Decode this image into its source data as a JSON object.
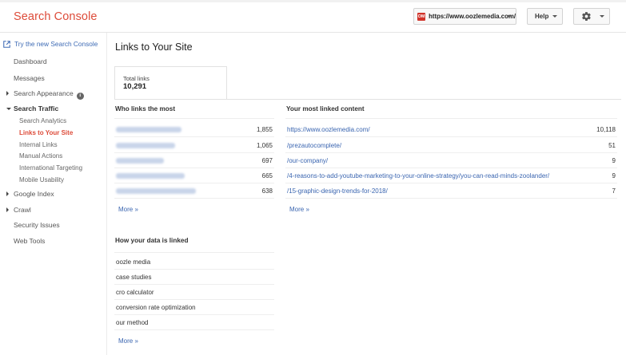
{
  "app": {
    "title": "Search Console",
    "property": "https://www.oozlemedia.com/",
    "favicon_text": "OM",
    "help_label": "Help",
    "brand_color": "#dd4b39",
    "link_color": "#3a65b0"
  },
  "sidebar": {
    "new_link": "Try the new Search Console",
    "items": [
      {
        "label": "Dashboard"
      },
      {
        "label": "Messages"
      },
      {
        "label": "Search Appearance"
      },
      {
        "label": "Search Traffic"
      },
      {
        "label": "Google Index"
      },
      {
        "label": "Crawl"
      },
      {
        "label": "Security Issues"
      },
      {
        "label": "Web Tools"
      }
    ],
    "subitems": [
      {
        "label": "Search Analytics"
      },
      {
        "label": "Links to Your Site",
        "active": true
      },
      {
        "label": "Internal Links"
      },
      {
        "label": "Manual Actions"
      },
      {
        "label": "International Targeting"
      },
      {
        "label": "Mobile Usability"
      }
    ]
  },
  "main": {
    "title": "Links to Your Site",
    "total_label": "Total links",
    "total_value": "10,291",
    "who_links": {
      "title": "Who links the most",
      "rows": [
        {
          "count": "1,855"
        },
        {
          "count": "1,065"
        },
        {
          "count": "697"
        },
        {
          "count": "665"
        },
        {
          "count": "638"
        }
      ],
      "more": "More »"
    },
    "most_linked": {
      "title": "Your most linked content",
      "rows": [
        {
          "url": "https://www.oozlemedia.com/",
          "count": "10,118"
        },
        {
          "url": "/prezautocomplete/",
          "count": "51"
        },
        {
          "url": "/our-company/",
          "count": "9"
        },
        {
          "url": "/4-reasons-to-add-youtube-marketing-to-your-online-strategy/you-can-read-minds-zoolander/",
          "count": "9"
        },
        {
          "url": "/15-graphic-design-trends-for-2018/",
          "count": "7"
        }
      ],
      "more": "More »"
    },
    "how_linked": {
      "title": "How your data is linked",
      "rows": [
        {
          "text": "oozle media"
        },
        {
          "text": "case studies"
        },
        {
          "text": "cro calculator"
        },
        {
          "text": "conversion rate optimization"
        },
        {
          "text": "our method"
        }
      ],
      "more": "More »"
    }
  }
}
